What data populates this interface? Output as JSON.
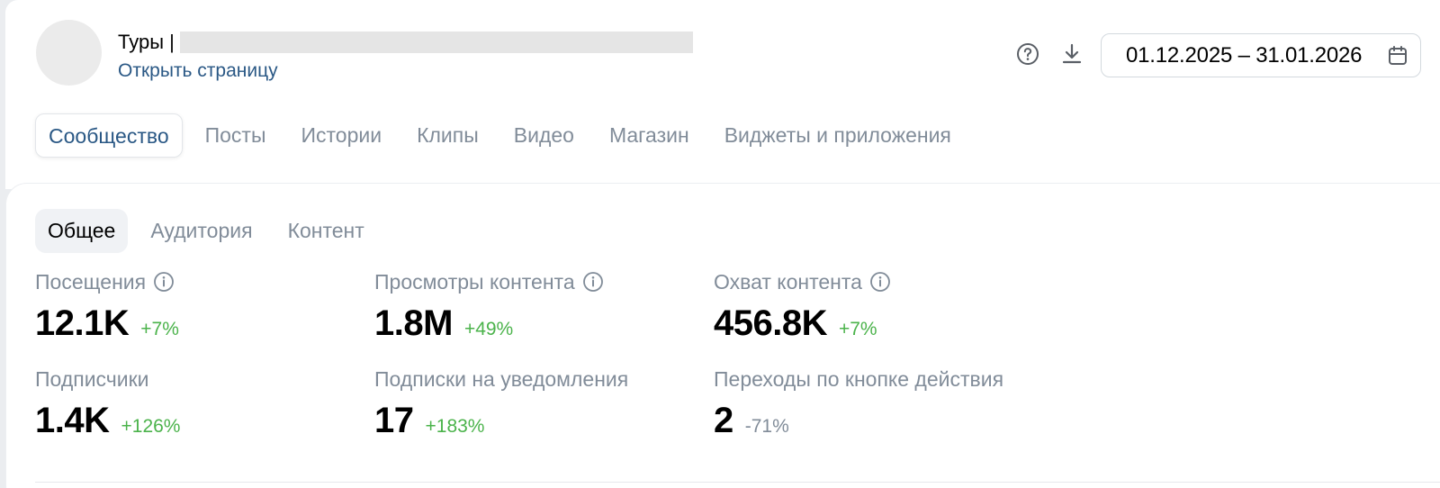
{
  "header": {
    "group_name": "Туры |",
    "open_page_link": "Открыть страницу",
    "date_range": "01.12.2025 – 31.01.2026",
    "icons": {
      "help": "question-circle-icon",
      "download": "download-icon",
      "calendar": "calendar-icon"
    }
  },
  "main_tabs": [
    {
      "label": "Сообщество",
      "active": true
    },
    {
      "label": "Посты",
      "active": false
    },
    {
      "label": "Истории",
      "active": false
    },
    {
      "label": "Клипы",
      "active": false
    },
    {
      "label": "Видео",
      "active": false
    },
    {
      "label": "Магазин",
      "active": false
    },
    {
      "label": "Виджеты и приложения",
      "active": false
    }
  ],
  "sub_tabs": [
    {
      "label": "Общее",
      "active": true
    },
    {
      "label": "Аудитория",
      "active": false
    },
    {
      "label": "Контент",
      "active": false
    }
  ],
  "metrics": [
    {
      "label": "Посещения",
      "value": "12.1K",
      "change": "+7%",
      "trend": "up",
      "info": true
    },
    {
      "label": "Просмотры контента",
      "value": "1.8M",
      "change": "+49%",
      "trend": "up",
      "info": true
    },
    {
      "label": "Охват контента",
      "value": "456.8K",
      "change": "+7%",
      "trend": "up",
      "info": true
    },
    {
      "label": "Подписчики",
      "value": "1.4K",
      "change": "+126%",
      "trend": "up",
      "info": false
    },
    {
      "label": "Подписки на уведомления",
      "value": "17",
      "change": "+183%",
      "trend": "up",
      "info": false
    },
    {
      "label": "Переходы по кнопке действия",
      "value": "2",
      "change": "-71%",
      "trend": "down",
      "info": false
    }
  ],
  "colors": {
    "accent": "#2a5885",
    "positive": "#4bb34b",
    "muted": "#818c99",
    "background": "#ebedf0"
  }
}
